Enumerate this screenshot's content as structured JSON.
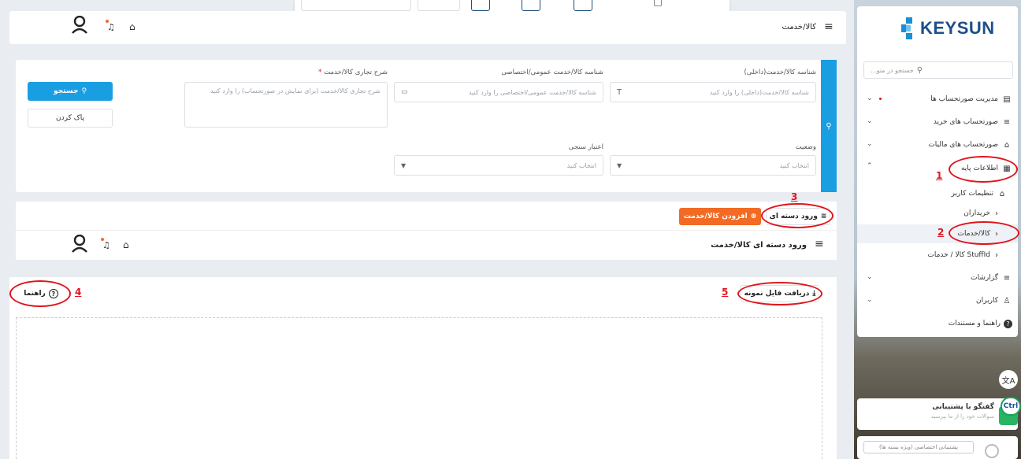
{
  "header": {
    "title": "کالا/خدمت"
  },
  "brand": {
    "logo_text": "KEYSUN"
  },
  "sidebar": {
    "search_placeholder": "جستجو در منو...",
    "items": [
      {
        "label": "مدیریت صورتحساب ها"
      },
      {
        "label": "صورتحساب های خرید"
      },
      {
        "label": "صورتحساب های مالیات"
      },
      {
        "label": "اطلاعات پایه"
      },
      {
        "label": "تنظیمات کاربر"
      },
      {
        "label": "خریداران"
      },
      {
        "label": "کالا/خدمات"
      },
      {
        "label": "StuffId کالا / خدمات"
      },
      {
        "label": "گزارشات"
      },
      {
        "label": "کاربران"
      },
      {
        "label": "راهنما و مستندات"
      }
    ],
    "support_title": "گفتگو با پشتیبانی",
    "support_sub": "سوالات خود را از ما بپرسید",
    "special_support": "پشتیبانی اختصاصی (ویژه بسته ها)",
    "ctrl_label": "Ctrl"
  },
  "filter": {
    "internal_id_label": "شناسه کالا/خدمت(داخلی)",
    "internal_id_placeholder": "شناسه کالا/خدمت(داخلی) را وارد کنید",
    "general_id_label": "شناسه کالا/خدمت عمومی/اختصاصی",
    "general_id_placeholder": "شناسه کالا/خدمت عمومی/اختصاصی را وارد کنید",
    "desc_label": "شرح تجاری کالا/خدمت",
    "desc_required": "*",
    "desc_placeholder": "شرح تجاری کالا/خدمت (برای نمایش در صورتحساب) را وارد کنید",
    "status_label": "وضعیت",
    "status_placeholder": "انتخاب کنید",
    "credit_label": "اعتبار سنجی",
    "credit_placeholder": "انتخاب کنید",
    "search_button": "جستجو",
    "clear_button": "پاک کردن"
  },
  "actions": {
    "bulk_import": "ورود دسته ای",
    "add_item": "افزودن کالا/خدمت"
  },
  "bulk": {
    "title": "ورود دسته ای کالا/خدمت",
    "download_sample": "دریافت فایل نمونه",
    "help": "راهنما"
  },
  "annotations": {
    "n1": "1",
    "n2": "2",
    "n3": "3",
    "n4": "4",
    "n5": "5"
  },
  "colors": {
    "primary": "#1a9ee2",
    "orange": "#f26a23",
    "annotation": "#e0141c"
  }
}
